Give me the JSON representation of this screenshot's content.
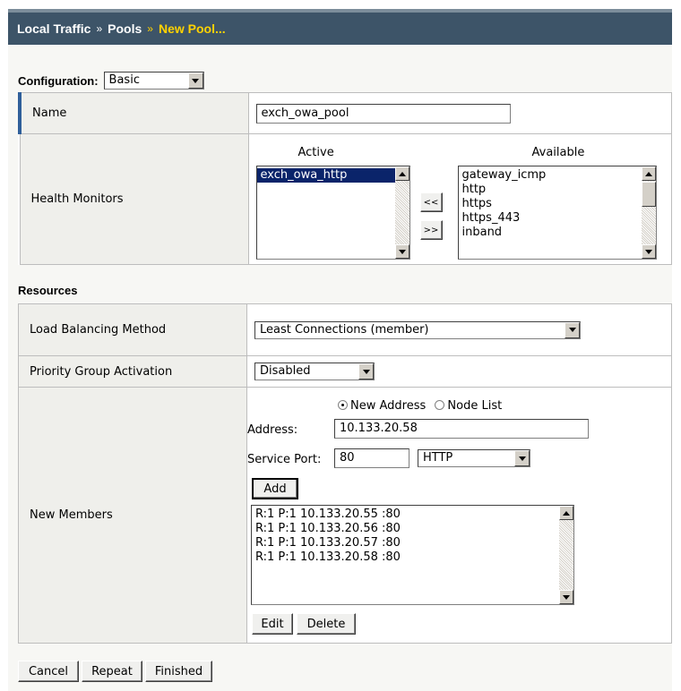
{
  "breadcrumb": {
    "part1": "Local Traffic",
    "sep": "»",
    "part2": "Pools",
    "part3": "New Pool..."
  },
  "configuration": {
    "label": "Configuration:",
    "value": "Basic"
  },
  "general": {
    "name_label": "Name",
    "name_value": "exch_owa_pool",
    "health_monitors_label": "Health Monitors",
    "active_header": "Active",
    "available_header": "Available",
    "active_items": [
      "exch_owa_http"
    ],
    "available_items": [
      "gateway_icmp",
      "http",
      "https",
      "https_443",
      "inband"
    ],
    "move_left": "<<",
    "move_right": ">>"
  },
  "resources": {
    "title": "Resources",
    "lb_method_label": "Load Balancing Method",
    "lb_method_value": "Least Connections (member)",
    "priority_label": "Priority Group Activation",
    "priority_value": "Disabled",
    "new_members_label": "New Members",
    "radio_new_address": "New Address",
    "radio_node_list": "Node List",
    "address_label": "Address:",
    "address_value": "10.133.20.58",
    "service_port_label": "Service Port:",
    "service_port_value": "80",
    "service_value": "HTTP",
    "add_button": "Add",
    "members": [
      "R:1 P:1 10.133.20.55 :80",
      "R:1 P:1 10.133.20.56 :80",
      "R:1 P:1 10.133.20.57 :80",
      "R:1 P:1 10.133.20.58 :80"
    ],
    "edit_button": "Edit",
    "delete_button": "Delete"
  },
  "actions": {
    "cancel": "Cancel",
    "repeat": "Repeat",
    "finished": "Finished"
  }
}
